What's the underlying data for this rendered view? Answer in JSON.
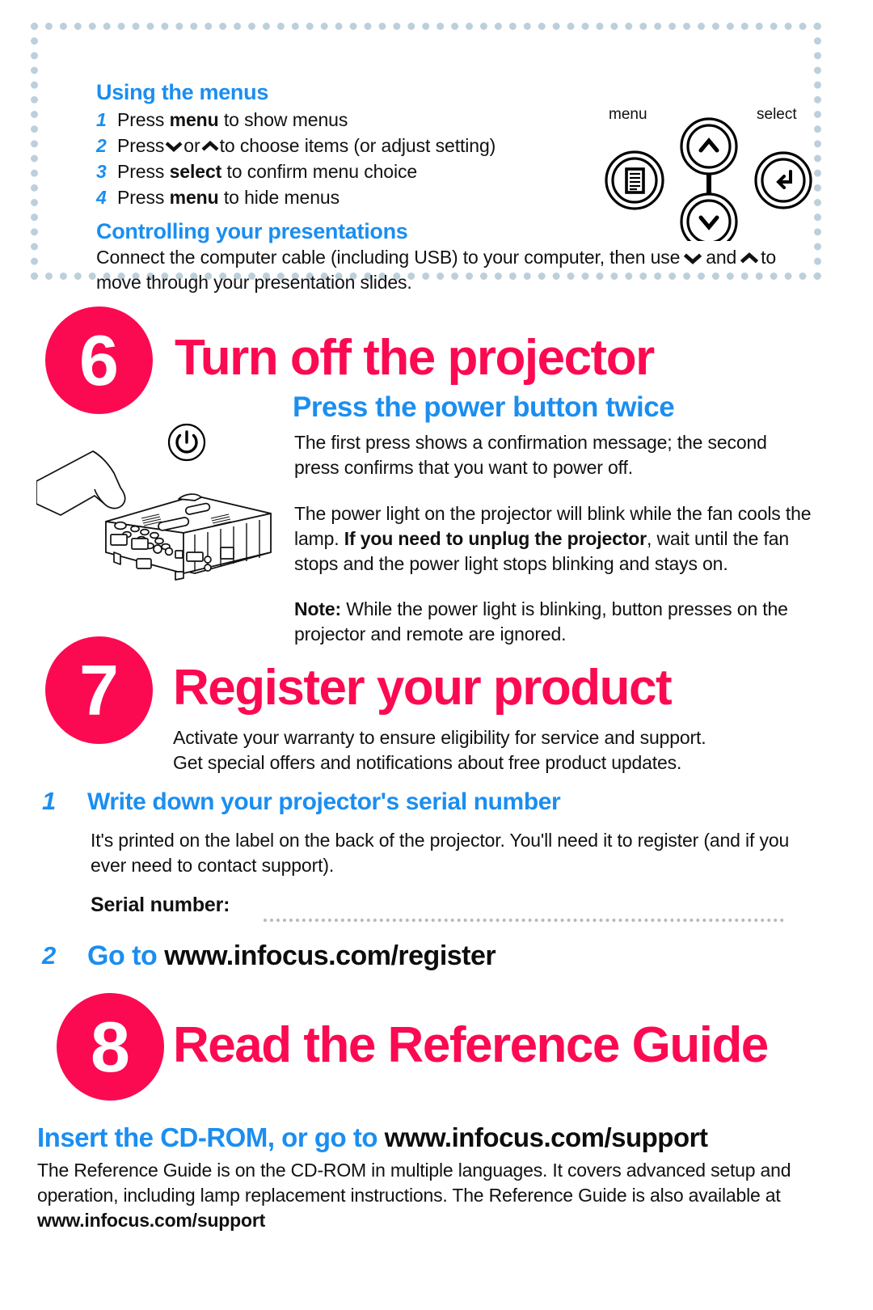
{
  "menu_panel": {
    "title": "Using the menus",
    "steps": [
      {
        "num": "1",
        "pre": "Press ",
        "bold": "menu",
        "post": " to show menus"
      },
      {
        "num": "2",
        "pre": "Press",
        "glyph_down": "⌄",
        "mid": "or",
        "glyph_up": "⌃",
        "post": "to choose items (or adjust setting)"
      },
      {
        "num": "3",
        "pre": "Press ",
        "bold": "select",
        "post": " to confirm menu choice"
      },
      {
        "num": "4",
        "pre": "Press ",
        "bold": "menu",
        "post": " to hide menus"
      }
    ],
    "title2": "Controlling your presentations",
    "body_a": "Connect the computer cable (including USB) to your computer, then use",
    "body_b": "and",
    "body_c": "to",
    "body_d": "move through your presentation slides.",
    "keypad": {
      "menu_label": "menu",
      "select_label": "select",
      "menu_icon": "menu-list-icon",
      "up_icon": "chevron-up-icon",
      "down_icon": "chevron-down-icon",
      "select_icon": "enter-return-icon"
    }
  },
  "step6": {
    "number": "6",
    "heading": "Turn off the projector",
    "subheading": "Press the power button twice",
    "power_icon": "power-button-icon",
    "illustration": "hand-pressing-projector-illustration",
    "para1": "The first press shows a confirmation message; the second press confirms that you want to power off.",
    "para2_a": "The power light on the projector will blink while the fan cools the lamp. ",
    "para2_bold": "If you need to unplug the projector",
    "para2_b": ", wait until the fan stops and the power light stops blinking and stays on.",
    "note_label": "Note:",
    "note_text": " While the power light is blinking, button presses on the projector and remote are ignored."
  },
  "step7": {
    "number": "7",
    "heading": "Register your product",
    "intro_line1": "Activate your warranty to ensure eligibility for service and support.",
    "intro_line2": "Get special offers and notifications about free product updates.",
    "sub1_num": "1",
    "sub1_head": "Write down your projector's serial number",
    "sub1_body": "It's printed on the label on the back of the projector. You'll need it to register (and if you ever need to contact support).",
    "serial_label": "Serial number:",
    "sub2_num": "2",
    "sub2_head_blue": "Go to ",
    "sub2_head_black": "www.infocus.com/register"
  },
  "step8": {
    "number": "8",
    "heading": "Read the Reference Guide",
    "bottom_head_blue": "Insert the CD-ROM, or go to ",
    "bottom_head_black": "www.infocus.com/support",
    "bottom_body_a": "The Reference Guide is on the CD-ROM in multiple languages. It covers advanced setup and operation, including lamp replacement instructions. The Reference Guide is also available at ",
    "bottom_body_bold": "www.infocus.com/support"
  },
  "colors": {
    "pink": "#fb0a52",
    "blue": "#1b8ef0",
    "dotted_border": "#bcd0dc",
    "text": "#111111",
    "serial_rule": "#b9b9b9"
  }
}
